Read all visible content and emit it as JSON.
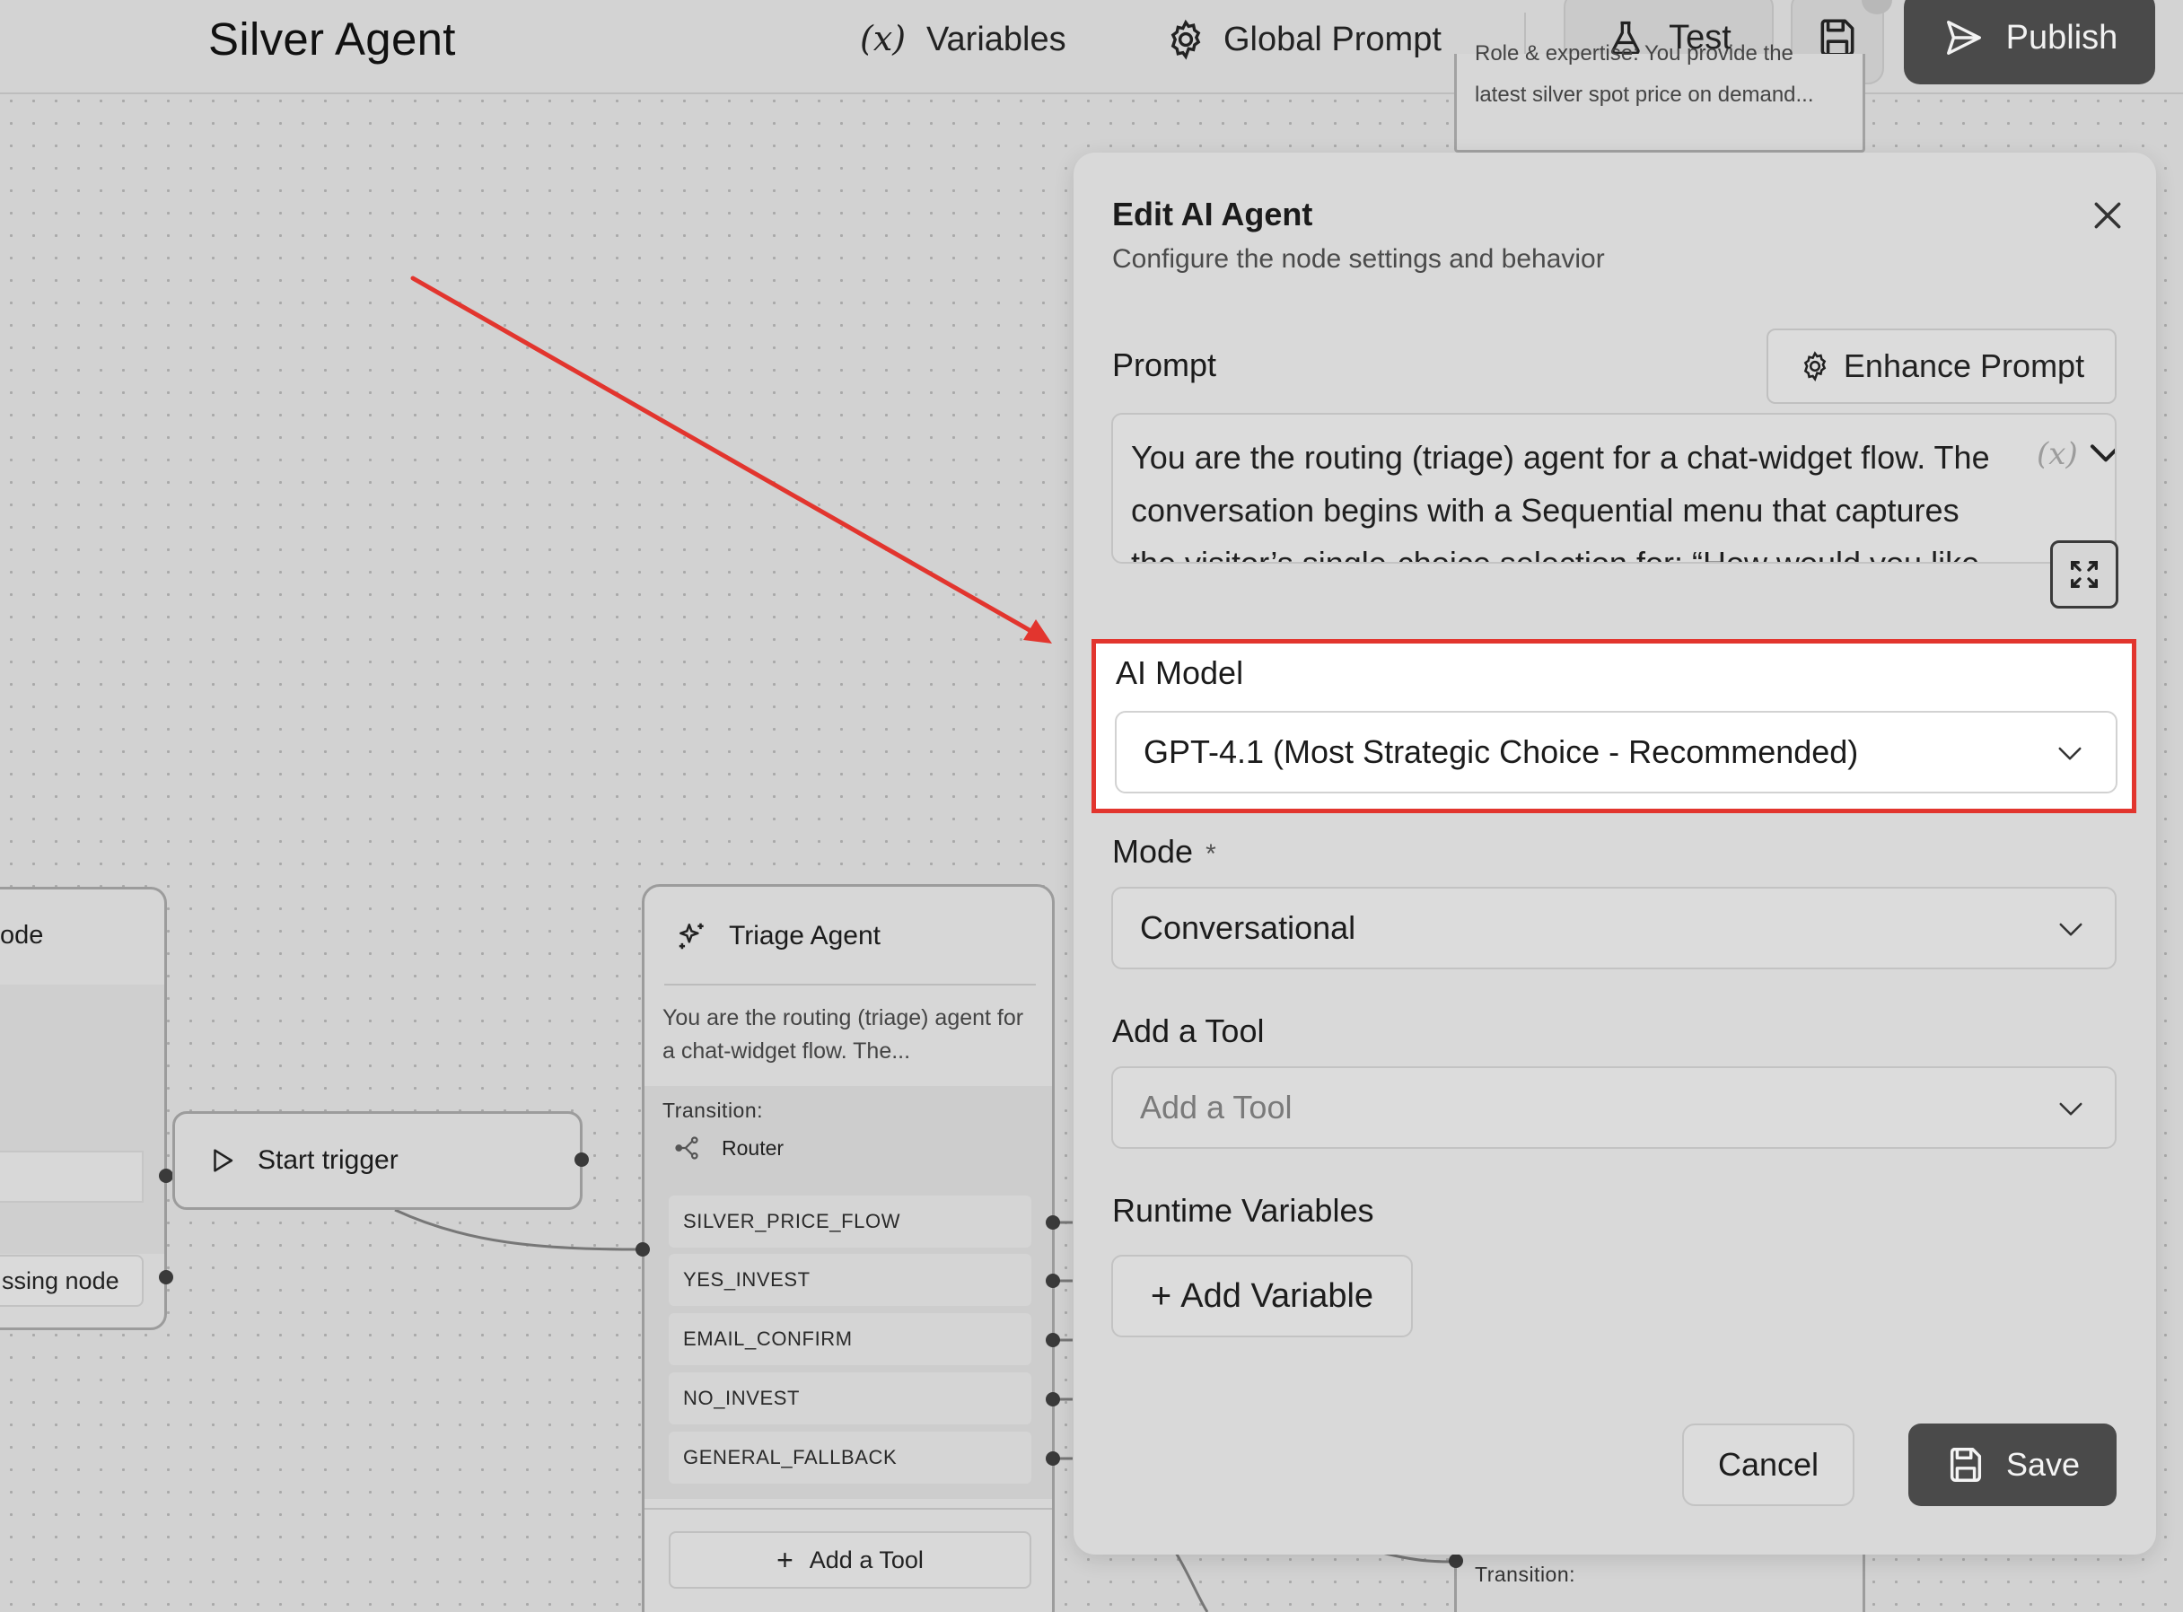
{
  "header": {
    "title": "Silver Agent",
    "variables_label": "Variables",
    "global_prompt_label": "Global Prompt",
    "test_label": "Test",
    "publish_label": "Publish"
  },
  "canvas": {
    "left_node": {
      "title_fragment": "ode",
      "row_label_fragment": "ssing node"
    },
    "start_node": {
      "label": "Start trigger"
    },
    "triage_node": {
      "title": "Triage Agent",
      "description": "You are the routing (triage) agent for a chat-widget flow. The...",
      "transition_label": "Transition:",
      "router_label": "Router",
      "transitions": [
        "SILVER_PRICE_FLOW",
        "YES_INVEST",
        "EMAIL_CONFIRM",
        "NO_INVEST",
        "GENERAL_FALLBACK"
      ],
      "add_tool_label": "Add a Tool"
    },
    "top_node": {
      "cut_text": "Role & expertise: You provide the",
      "text": "latest silver spot price on demand..."
    },
    "bottom_node": {
      "transition_label": "Transition:"
    }
  },
  "panel": {
    "title": "Edit AI Agent",
    "subtitle": "Configure the node settings and behavior",
    "prompt_label": "Prompt",
    "enhance_label": "Enhance Prompt",
    "prompt_text": "You are the routing (triage) agent for a chat-widget flow. The conversation begins with a Sequential menu that captures the visitor’s single-choice selection for: “How would you like to begin?” Once the selection is recognized, “What do",
    "ai_model_label": "AI Model",
    "ai_model_value": "GPT-4.1 (Most Strategic Choice - Recommended)",
    "mode_label": "Mode",
    "mode_required": "*",
    "mode_value": "Conversational",
    "tool_label": "Add a Tool",
    "tool_placeholder": "Add a Tool",
    "runtime_label": "Runtime Variables",
    "add_variable_label": "Add Variable",
    "cancel_label": "Cancel",
    "save_label": "Save"
  },
  "colors": {
    "highlight_border": "#e2352e",
    "arrow": "#e2352e",
    "primary_button": "#4a4a4a"
  }
}
